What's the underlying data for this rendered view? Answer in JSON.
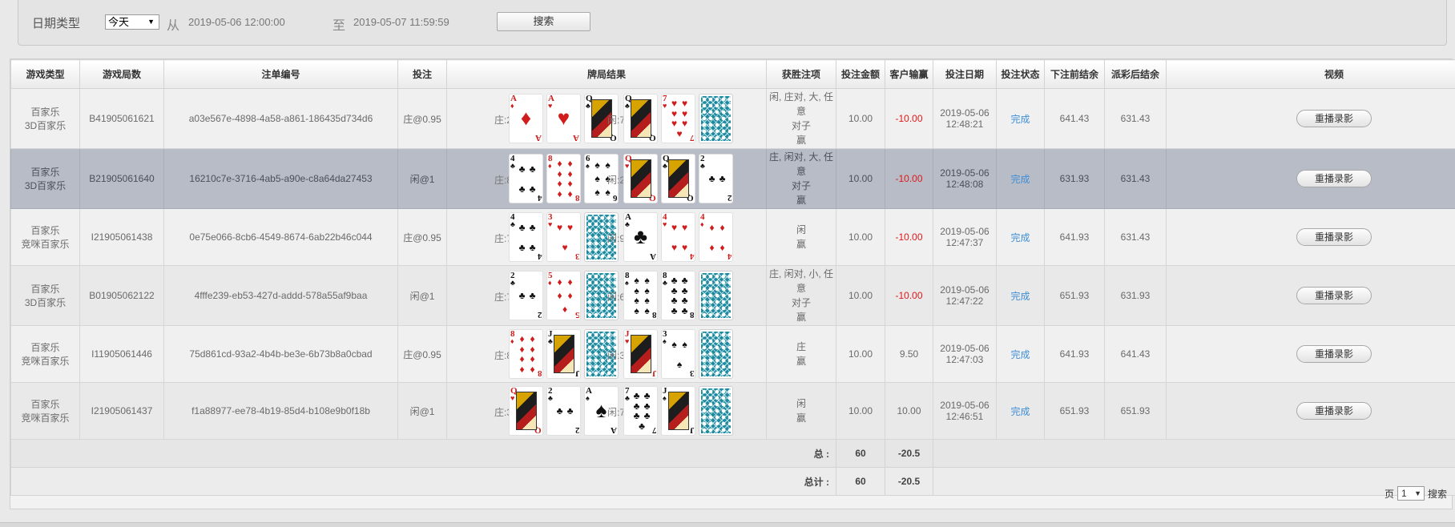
{
  "filter": {
    "date_type_label": "日期类型",
    "date_type_value": "今天",
    "from_label": "从",
    "start_time": "2019-05-06 12:00:00",
    "to_label": "至",
    "end_time": "2019-05-07 11:59:59",
    "search_button": "搜索"
  },
  "table": {
    "headers": [
      "游戏类型",
      "游戏局数",
      "注单编号",
      "投注",
      "牌局结果",
      "获胜注项",
      "投注金额",
      "客户输赢",
      "投注日期",
      "投注状态",
      "下注前结余",
      "派彩后结余",
      "视频"
    ],
    "replay_label": "重播录影",
    "rows": [
      {
        "game_type": [
          "百家乐",
          "3D百家乐"
        ],
        "round": "B41905061621",
        "bet_id": "a03e567e-4898-4a58-a861-186435d734d6",
        "bet": "庄@0.95",
        "banker_label": "庄:2",
        "player_label": "闲:7",
        "banker_cards": [
          {
            "r": "A",
            "s": "♦",
            "c": "red"
          },
          {
            "r": "A",
            "s": "♥",
            "c": "red"
          },
          {
            "r": "Q",
            "s": "♣",
            "c": "black",
            "face": true
          }
        ],
        "player_cards": [
          {
            "r": "Q",
            "s": "♣",
            "c": "black",
            "face": true
          },
          {
            "r": "7",
            "s": "♥",
            "c": "red"
          },
          {
            "back": true
          }
        ],
        "win": [
          "闲, 庄对, 大, 任意",
          "对子",
          "赢"
        ],
        "amount": "10.00",
        "winloss": "-10.00",
        "neg": true,
        "date": "2019-05-06",
        "time": "12:48:21",
        "status": "完成",
        "before": "641.43",
        "after": "631.43"
      },
      {
        "game_type": [
          "百家乐",
          "3D百家乐"
        ],
        "round": "B21905061640",
        "bet_id": "16210c7e-3716-4ab5-a90e-c8a64da27453",
        "bet": "闲@1",
        "banker_label": "庄:8",
        "player_label": "闲:2",
        "banker_cards": [
          {
            "r": "4",
            "s": "♣",
            "c": "black"
          },
          {
            "r": "8",
            "s": "♦",
            "c": "red"
          },
          {
            "r": "6",
            "s": "♠",
            "c": "black"
          }
        ],
        "player_cards": [
          {
            "r": "Q",
            "s": "♥",
            "c": "red",
            "face": true
          },
          {
            "r": "Q",
            "s": "♣",
            "c": "black",
            "face": true
          },
          {
            "r": "2",
            "s": "♣",
            "c": "black"
          }
        ],
        "win": [
          "庄, 闲对, 大, 任意",
          "对子",
          "赢"
        ],
        "amount": "10.00",
        "winloss": "-10.00",
        "neg": true,
        "date": "2019-05-06",
        "time": "12:48:08",
        "status": "完成",
        "before": "631.93",
        "after": "631.43"
      },
      {
        "game_type": [
          "百家乐",
          "竞咪百家乐"
        ],
        "round": "I21905061438",
        "bet_id": "0e75e066-8cb6-4549-8674-6ab22b46c044",
        "bet": "庄@0.95",
        "banker_label": "庄:7",
        "player_label": "闲:9",
        "banker_cards": [
          {
            "r": "4",
            "s": "♣",
            "c": "black"
          },
          {
            "r": "3",
            "s": "♥",
            "c": "red"
          },
          {
            "back": true
          }
        ],
        "player_cards": [
          {
            "r": "A",
            "s": "♣",
            "c": "black"
          },
          {
            "r": "4",
            "s": "♥",
            "c": "red"
          },
          {
            "r": "4",
            "s": "♦",
            "c": "red"
          }
        ],
        "win": [
          "闲",
          "赢"
        ],
        "amount": "10.00",
        "winloss": "-10.00",
        "neg": true,
        "date": "2019-05-06",
        "time": "12:47:37",
        "status": "完成",
        "before": "641.93",
        "after": "631.43"
      },
      {
        "game_type": [
          "百家乐",
          "3D百家乐"
        ],
        "round": "B01905062122",
        "bet_id": "4fffe239-eb53-427d-addd-578a55af9baa",
        "bet": "闲@1",
        "banker_label": "庄:7",
        "player_label": "闲:6",
        "banker_cards": [
          {
            "r": "2",
            "s": "♣",
            "c": "black"
          },
          {
            "r": "5",
            "s": "♦",
            "c": "red"
          },
          {
            "back": true
          }
        ],
        "player_cards": [
          {
            "r": "8",
            "s": "♠",
            "c": "black"
          },
          {
            "r": "8",
            "s": "♣",
            "c": "black"
          },
          {
            "back": true
          }
        ],
        "win": [
          "庄, 闲对, 小, 任意",
          "对子",
          "赢"
        ],
        "amount": "10.00",
        "winloss": "-10.00",
        "neg": true,
        "date": "2019-05-06",
        "time": "12:47:22",
        "status": "完成",
        "before": "651.93",
        "after": "631.93"
      },
      {
        "game_type": [
          "百家乐",
          "竞咪百家乐"
        ],
        "round": "I11905061446",
        "bet_id": "75d861cd-93a2-4b4b-be3e-6b73b8a0cbad",
        "bet": "庄@0.95",
        "banker_label": "庄:8",
        "player_label": "闲:3",
        "banker_cards": [
          {
            "r": "8",
            "s": "♦",
            "c": "red"
          },
          {
            "r": "J",
            "s": "♣",
            "c": "black",
            "face": true
          },
          {
            "back": true
          }
        ],
        "player_cards": [
          {
            "r": "J",
            "s": "♥",
            "c": "red",
            "face": true
          },
          {
            "r": "3",
            "s": "♠",
            "c": "black"
          },
          {
            "back": true
          }
        ],
        "win": [
          "庄",
          "赢"
        ],
        "amount": "10.00",
        "winloss": "9.50",
        "neg": false,
        "date": "2019-05-06",
        "time": "12:47:03",
        "status": "完成",
        "before": "641.93",
        "after": "641.43"
      },
      {
        "game_type": [
          "百家乐",
          "竞咪百家乐"
        ],
        "round": "I21905061437",
        "bet_id": "f1a88977-ee78-4b19-85d4-b108e9b0f18b",
        "bet": "闲@1",
        "banker_label": "庄:3",
        "player_label": "闲:7",
        "banker_cards": [
          {
            "r": "Q",
            "s": "♥",
            "c": "red",
            "face": true
          },
          {
            "r": "2",
            "s": "♣",
            "c": "black"
          },
          {
            "r": "A",
            "s": "♠",
            "c": "black"
          }
        ],
        "player_cards": [
          {
            "r": "7",
            "s": "♣",
            "c": "black"
          },
          {
            "r": "J",
            "s": "♠",
            "c": "black",
            "face": true
          },
          {
            "back": true
          }
        ],
        "win": [
          "闲",
          "赢"
        ],
        "amount": "10.00",
        "winloss": "10.00",
        "neg": false,
        "date": "2019-05-06",
        "time": "12:46:51",
        "status": "完成",
        "before": "651.93",
        "after": "651.93"
      }
    ],
    "subtotal_label": "总 :",
    "subtotal_amount": "60",
    "subtotal_winloss": "-20.5",
    "grandtotal_label": "总计 :",
    "grandtotal_amount": "60",
    "grandtotal_winloss": "-20.5"
  },
  "pager": {
    "page_label": "页",
    "page_value": "1",
    "search_label": "搜索"
  },
  "colors": {
    "negative": "#e01818",
    "status": "#3f8fd8",
    "selected_row": "#b8bcc6"
  }
}
